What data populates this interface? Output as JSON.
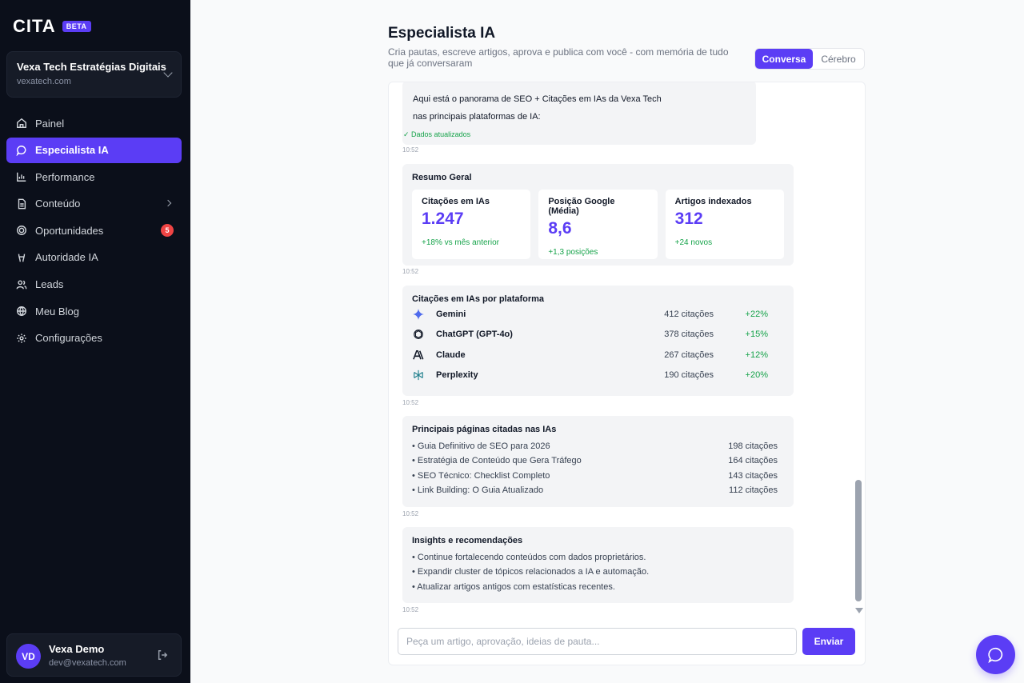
{
  "brand": {
    "logo": "CITA",
    "badge": "BETA"
  },
  "account": {
    "name": "Vexa Tech Estratégias Digitais",
    "domain": "vexatech.com"
  },
  "nav": {
    "items": [
      {
        "label": "Painel",
        "icon": "home-icon"
      },
      {
        "label": "Especialista IA",
        "icon": "chat-icon",
        "active": true
      },
      {
        "label": "Performance",
        "icon": "bar-chart-icon"
      },
      {
        "label": "Conteúdo",
        "icon": "document-icon"
      },
      {
        "label": "Oportunidades",
        "icon": "target-icon",
        "badge": "5"
      },
      {
        "label": "Autoridade IA",
        "icon": "award-icon"
      },
      {
        "label": "Leads",
        "icon": "users-icon"
      },
      {
        "label": "Meu Blog",
        "icon": "globe-icon"
      },
      {
        "label": "Configurações",
        "icon": "gear-icon"
      }
    ]
  },
  "user": {
    "initials": "VD",
    "name": "Vexa Demo",
    "email": "dev@vexatech.com"
  },
  "header": {
    "title": "Especialista IA",
    "subtitle": "Cria pautas, escreve artigos, aprova e publica com você - com memória de tudo que já conversaram",
    "tab_conversa": "Conversa",
    "tab_cerebro": "Cérebro"
  },
  "chat": {
    "intro": {
      "line1": "Aqui está o panorama de SEO + Citações em IAs da Vexa Tech",
      "line2": "nas principais plataformas de IA:",
      "status": "✓ Dados atualizados",
      "time": "10:52"
    },
    "summary": {
      "title": "Resumo Geral",
      "stats": [
        {
          "label": "Citações em IAs",
          "value": "1.247",
          "delta": "+18% vs mês anterior"
        },
        {
          "label": "Posição Google (Média)",
          "value": "8,6",
          "delta": "+1,3 posições"
        },
        {
          "label": "Artigos indexados",
          "value": "312",
          "delta": "+24 novos"
        }
      ],
      "time": "10:52"
    },
    "platforms": {
      "title": "Citações em IAs por plataforma",
      "rows": [
        {
          "name": "Gemini",
          "count": "412 citações",
          "growth": "+22%"
        },
        {
          "name": "ChatGPT (GPT-4o)",
          "count": "378 citações",
          "growth": "+15%"
        },
        {
          "name": "Claude",
          "count": "267 citações",
          "growth": "+12%"
        },
        {
          "name": "Perplexity",
          "count": "190 citações",
          "growth": "+20%"
        }
      ],
      "time": "10:52"
    },
    "pages": {
      "title": "Principais páginas citadas nas IAs",
      "rows": [
        {
          "name": "• Guia Definitivo de SEO para 2026",
          "count": "198 citações"
        },
        {
          "name": "• Estratégia de Conteúdo que Gera Tráfego",
          "count": "164 citações"
        },
        {
          "name": "• SEO Técnico: Checklist Completo",
          "count": "143 citações"
        },
        {
          "name": "• Link Building: O Guia Atualizado",
          "count": "112 citações"
        }
      ],
      "time": "10:52"
    },
    "insights": {
      "title": "Insights e recomendações",
      "rows": [
        "• Continue fortalecendo conteúdos com dados proprietários.",
        "• Expandir cluster de tópicos relacionados a IA e automação.",
        "• Atualizar artigos antigos com estatísticas recentes."
      ],
      "time": "10:52"
    }
  },
  "composer": {
    "placeholder": "Peça um artigo, aprovação, ideias de pauta...",
    "send_label": "Enviar"
  },
  "colors": {
    "accent": "#5b3df5",
    "sidebar": "#0b0f1a",
    "positive": "#16a34a",
    "badge": "#ef4444"
  }
}
